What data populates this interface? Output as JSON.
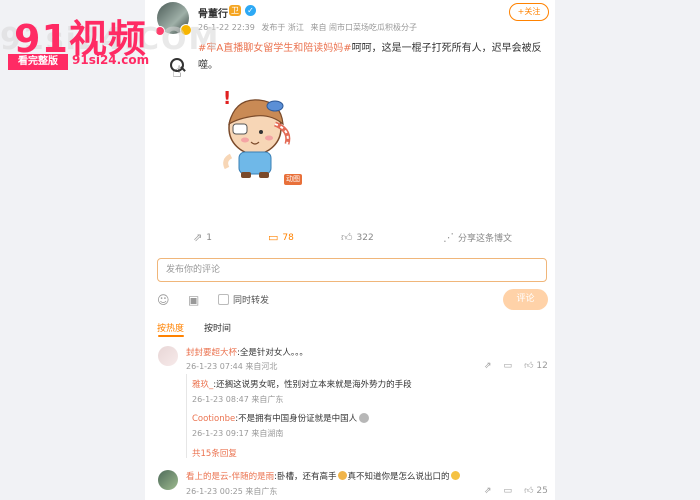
{
  "post": {
    "username": "骨董行",
    "badge_vip": "卫",
    "badge_verified": "✓",
    "time": "26-1-22 22:39",
    "published_from": "发布于 浙江",
    "source": "来自 闹市口菜场吃瓜积极分子",
    "follow_label": "+关注",
    "hashtag": "#牢A直播聊女留学生和陪读妈妈#",
    "text": "呵呵，这是一棍子打死所有人，迟早会被反噬。",
    "gif_badge": "动图"
  },
  "actions": {
    "repost_count": "1",
    "comment_count": "78",
    "like_count": "322",
    "share_label": "分享这条博文"
  },
  "composer": {
    "placeholder": "发布你的评论",
    "repost_label": "同时转发",
    "submit_label": "评论"
  },
  "tabs": [
    {
      "label": "按热度",
      "active": true
    },
    {
      "label": "按时间",
      "active": false
    }
  ],
  "comments": [
    {
      "name": "封封要超大杯",
      "text": "全是针对女人。。。",
      "meta": "26-1-23 07:44 来自河北",
      "likes": "12",
      "replies": [
        {
          "name": "雅玖_",
          "text": "还搁这说男女呢，性别对立本来就是海外势力的手段",
          "meta": "26-1-23 08:47 来自广东"
        },
        {
          "name": "Cootionbe",
          "text": "不是拥有中国身份证就是中国人",
          "meta": "26-1-23 09:17 来自湖南"
        }
      ],
      "more": "共15条回复"
    },
    {
      "name": "看上的是云-伴随的是雨",
      "text": "卧槽，还有高手",
      "text2": "真不知道你是怎么说出口的",
      "meta": "26-1-23 00:25 来自广东",
      "likes": "25"
    }
  ],
  "watermark": {
    "logo": "91视频",
    "ghost": "91si24.COM",
    "button": "看完整版",
    "url": "91si24.com"
  },
  "colors": {
    "accent": "#ff8200",
    "link": "#eb7350",
    "watermark": "#ff2b64"
  }
}
